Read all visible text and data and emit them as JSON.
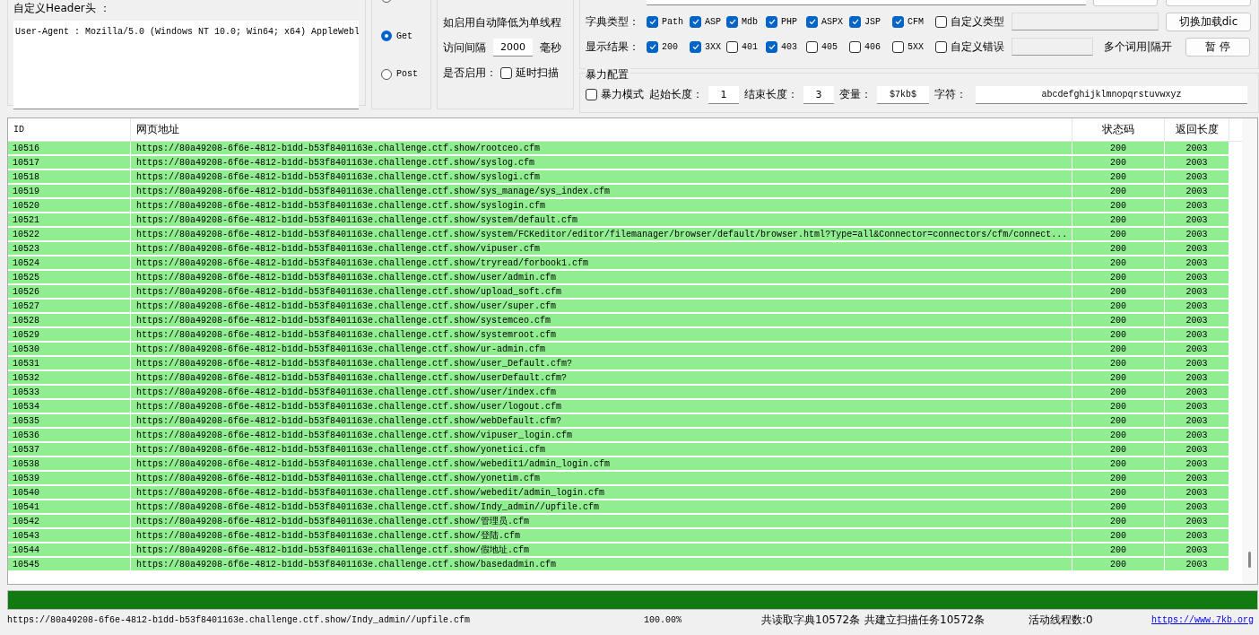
{
  "header_panel": {
    "label": "自定义Header头 ：",
    "value": "User-Agent : Mozilla/5.0 (Windows NT 10.0; Win64; x64) AppleWebl"
  },
  "methods": [
    {
      "selected": false
    },
    {
      "label": "Get",
      "selected": true
    },
    {
      "label": "Post",
      "selected": false
    }
  ],
  "throttle": {
    "note_2": "如启用自动降低为单线程",
    "interval_label": "访问间隔",
    "interval": "2000",
    "unit": "毫秒",
    "enable_label": "是否启用：",
    "delay": {
      "label": "延时扫描",
      "checked": false
    }
  },
  "scan": {
    "dict_label": "字典类型：",
    "dict_types": [
      {
        "label": "Path",
        "checked": true
      },
      {
        "label": "ASP",
        "checked": true
      },
      {
        "label": "Mdb",
        "checked": true
      },
      {
        "label": "PHP",
        "checked": true
      },
      {
        "label": "ASPX",
        "checked": true
      },
      {
        "label": "JSP",
        "checked": true
      },
      {
        "label": "CFM",
        "checked": true
      },
      {
        "label": "自定义类型",
        "checked": false
      }
    ],
    "load_button": "切换加载dic",
    "result_label": "显示结果：",
    "results": [
      {
        "label": "200",
        "checked": true
      },
      {
        "label": "3XX",
        "checked": true
      },
      {
        "label": "401",
        "checked": false
      },
      {
        "label": "403",
        "checked": true
      },
      {
        "label": "405",
        "checked": false
      },
      {
        "label": "406",
        "checked": false
      },
      {
        "label": "5XX",
        "checked": false
      },
      {
        "label": "自定义错误",
        "checked": false
      }
    ],
    "hint": "多个词用|隔开",
    "pause_button": "暂 停"
  },
  "brute": {
    "title": "暴力配置",
    "mode": {
      "label": "暴力模式",
      "checked": false
    },
    "start_label": "起始长度：",
    "start": "1",
    "end_label": "结束长度：",
    "end": "3",
    "var_label": "变量：",
    "var": "$7kb$",
    "chars_label": "字符：",
    "chars": "abcdefghijklmnopqrstuvwxyz"
  },
  "table": {
    "columns": [
      "ID",
      "网页地址",
      "状态码",
      "返回长度"
    ],
    "rows": [
      [
        "10516",
        "https://80a49208-6f6e-4812-b1dd-b53f8401163e.challenge.ctf.show/rootceo.cfm",
        "200",
        "2003"
      ],
      [
        "10517",
        "https://80a49208-6f6e-4812-b1dd-b53f8401163e.challenge.ctf.show/syslog.cfm",
        "200",
        "2003"
      ],
      [
        "10518",
        "https://80a49208-6f6e-4812-b1dd-b53f8401163e.challenge.ctf.show/syslogi.cfm",
        "200",
        "2003"
      ],
      [
        "10519",
        "https://80a49208-6f6e-4812-b1dd-b53f8401163e.challenge.ctf.show/sys_manage/sys_index.cfm",
        "200",
        "2003"
      ],
      [
        "10520",
        "https://80a49208-6f6e-4812-b1dd-b53f8401163e.challenge.ctf.show/syslogin.cfm",
        "200",
        "2003"
      ],
      [
        "10521",
        "https://80a49208-6f6e-4812-b1dd-b53f8401163e.challenge.ctf.show/system/default.cfm",
        "200",
        "2003"
      ],
      [
        "10522",
        "https://80a49208-6f6e-4812-b1dd-b53f8401163e.challenge.ctf.show/system/FCKeditor/editor/filemanager/browser/default/browser.html?Type=all&Connector=connectors/cfm/connect...",
        "200",
        "2003"
      ],
      [
        "10523",
        "https://80a49208-6f6e-4812-b1dd-b53f8401163e.challenge.ctf.show/vipuser.cfm",
        "200",
        "2003"
      ],
      [
        "10524",
        "https://80a49208-6f6e-4812-b1dd-b53f8401163e.challenge.ctf.show/tryread/forbook1.cfm",
        "200",
        "2003"
      ],
      [
        "10525",
        "https://80a49208-6f6e-4812-b1dd-b53f8401163e.challenge.ctf.show/user/admin.cfm",
        "200",
        "2003"
      ],
      [
        "10526",
        "https://80a49208-6f6e-4812-b1dd-b53f8401163e.challenge.ctf.show/upload_soft.cfm",
        "200",
        "2003"
      ],
      [
        "10527",
        "https://80a49208-6f6e-4812-b1dd-b53f8401163e.challenge.ctf.show/user/super.cfm",
        "200",
        "2003"
      ],
      [
        "10528",
        "https://80a49208-6f6e-4812-b1dd-b53f8401163e.challenge.ctf.show/systemceo.cfm",
        "200",
        "2003"
      ],
      [
        "10529",
        "https://80a49208-6f6e-4812-b1dd-b53f8401163e.challenge.ctf.show/systemroot.cfm",
        "200",
        "2003"
      ],
      [
        "10530",
        "https://80a49208-6f6e-4812-b1dd-b53f8401163e.challenge.ctf.show/ur-admin.cfm",
        "200",
        "2003"
      ],
      [
        "10531",
        "https://80a49208-6f6e-4812-b1dd-b53f8401163e.challenge.ctf.show/user_Default.cfm?",
        "200",
        "2003"
      ],
      [
        "10532",
        "https://80a49208-6f6e-4812-b1dd-b53f8401163e.challenge.ctf.show/userDefault.cfm?",
        "200",
        "2003"
      ],
      [
        "10533",
        "https://80a49208-6f6e-4812-b1dd-b53f8401163e.challenge.ctf.show/user/index.cfm",
        "200",
        "2003"
      ],
      [
        "10534",
        "https://80a49208-6f6e-4812-b1dd-b53f8401163e.challenge.ctf.show/user/logout.cfm",
        "200",
        "2003"
      ],
      [
        "10535",
        "https://80a49208-6f6e-4812-b1dd-b53f8401163e.challenge.ctf.show/webDefault.cfm?",
        "200",
        "2003"
      ],
      [
        "10536",
        "https://80a49208-6f6e-4812-b1dd-b53f8401163e.challenge.ctf.show/vipuser_login.cfm",
        "200",
        "2003"
      ],
      [
        "10537",
        "https://80a49208-6f6e-4812-b1dd-b53f8401163e.challenge.ctf.show/yonetici.cfm",
        "200",
        "2003"
      ],
      [
        "10538",
        "https://80a49208-6f6e-4812-b1dd-b53f8401163e.challenge.ctf.show/webedit1/admin_login.cfm",
        "200",
        "2003"
      ],
      [
        "10539",
        "https://80a49208-6f6e-4812-b1dd-b53f8401163e.challenge.ctf.show/yonetim.cfm",
        "200",
        "2003"
      ],
      [
        "10540",
        "https://80a49208-6f6e-4812-b1dd-b53f8401163e.challenge.ctf.show/webedit/admin_login.cfm",
        "200",
        "2003"
      ],
      [
        "10541",
        "https://80a49208-6f6e-4812-b1dd-b53f8401163e.challenge.ctf.show/Indy_admin//upfile.cfm",
        "200",
        "2003"
      ],
      [
        "10542",
        "https://80a49208-6f6e-4812-b1dd-b53f8401163e.challenge.ctf.show/管理员.cfm",
        "200",
        "2003"
      ],
      [
        "10543",
        "https://80a49208-6f6e-4812-b1dd-b53f8401163e.challenge.ctf.show/登陆.cfm",
        "200",
        "2003"
      ],
      [
        "10544",
        "https://80a49208-6f6e-4812-b1dd-b53f8401163e.challenge.ctf.show/假地址.cfm",
        "200",
        "2003"
      ],
      [
        "10545",
        "https://80a49208-6f6e-4812-b1dd-b53f8401163e.challenge.ctf.show/basedadmin.cfm",
        "200",
        "2003"
      ]
    ]
  },
  "progress": {
    "level": 1
  },
  "status_bar": {
    "current": "https://80a49208-6f6e-4812-b1dd-b53f8401163e.challenge.ctf.show/Indy_admin//upfile.cfm",
    "percent": "100.00%",
    "dict_count": "共读取字典10572条",
    "task_count": "共建立扫描任务10572条",
    "threads": "活动线程数:0",
    "link": "https://www.7kb.org"
  }
}
